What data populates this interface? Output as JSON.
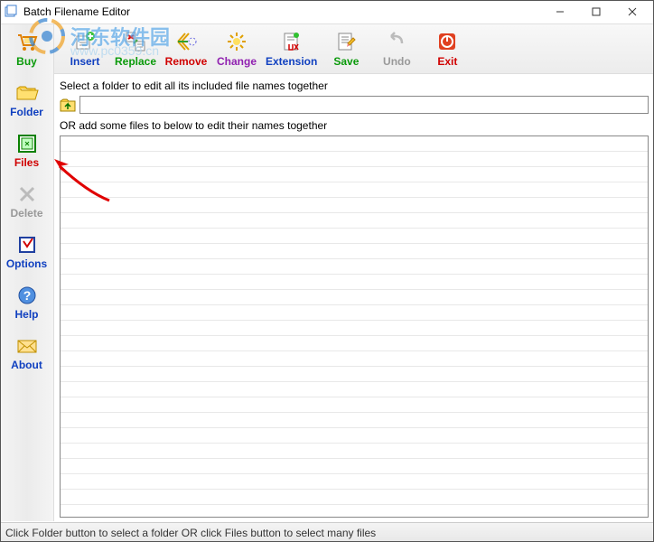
{
  "window": {
    "title": "Batch Filename Editor"
  },
  "sidebar": {
    "items": [
      {
        "label": "Buy",
        "style": "green"
      },
      {
        "label": "Folder",
        "style": "blue"
      },
      {
        "label": "Files",
        "style": "red"
      },
      {
        "label": "Delete",
        "style": "gray"
      },
      {
        "label": "Options",
        "style": "blue"
      },
      {
        "label": "Help",
        "style": "blue"
      },
      {
        "label": "About",
        "style": "blue"
      }
    ]
  },
  "toolbar": {
    "items": [
      {
        "label": "Insert",
        "style": "blue"
      },
      {
        "label": "Replace",
        "style": "green"
      },
      {
        "label": "Remove",
        "style": "red"
      },
      {
        "label": "Change",
        "style": "purple"
      },
      {
        "label": "Extension",
        "style": "blue"
      },
      {
        "label": "Save",
        "style": "green"
      },
      {
        "label": "Undo",
        "style": "gray"
      },
      {
        "label": "Exit",
        "style": "red"
      }
    ]
  },
  "workarea": {
    "instruction1": "Select a folder to edit all its included file names together",
    "folder_value": "",
    "instruction2": "OR add some files to below to edit their names together"
  },
  "statusbar": {
    "text": "Click Folder button to select a folder OR click Files button to select many files"
  },
  "watermark": {
    "text": "河东软件园",
    "url": "www.pc0359.cn"
  }
}
